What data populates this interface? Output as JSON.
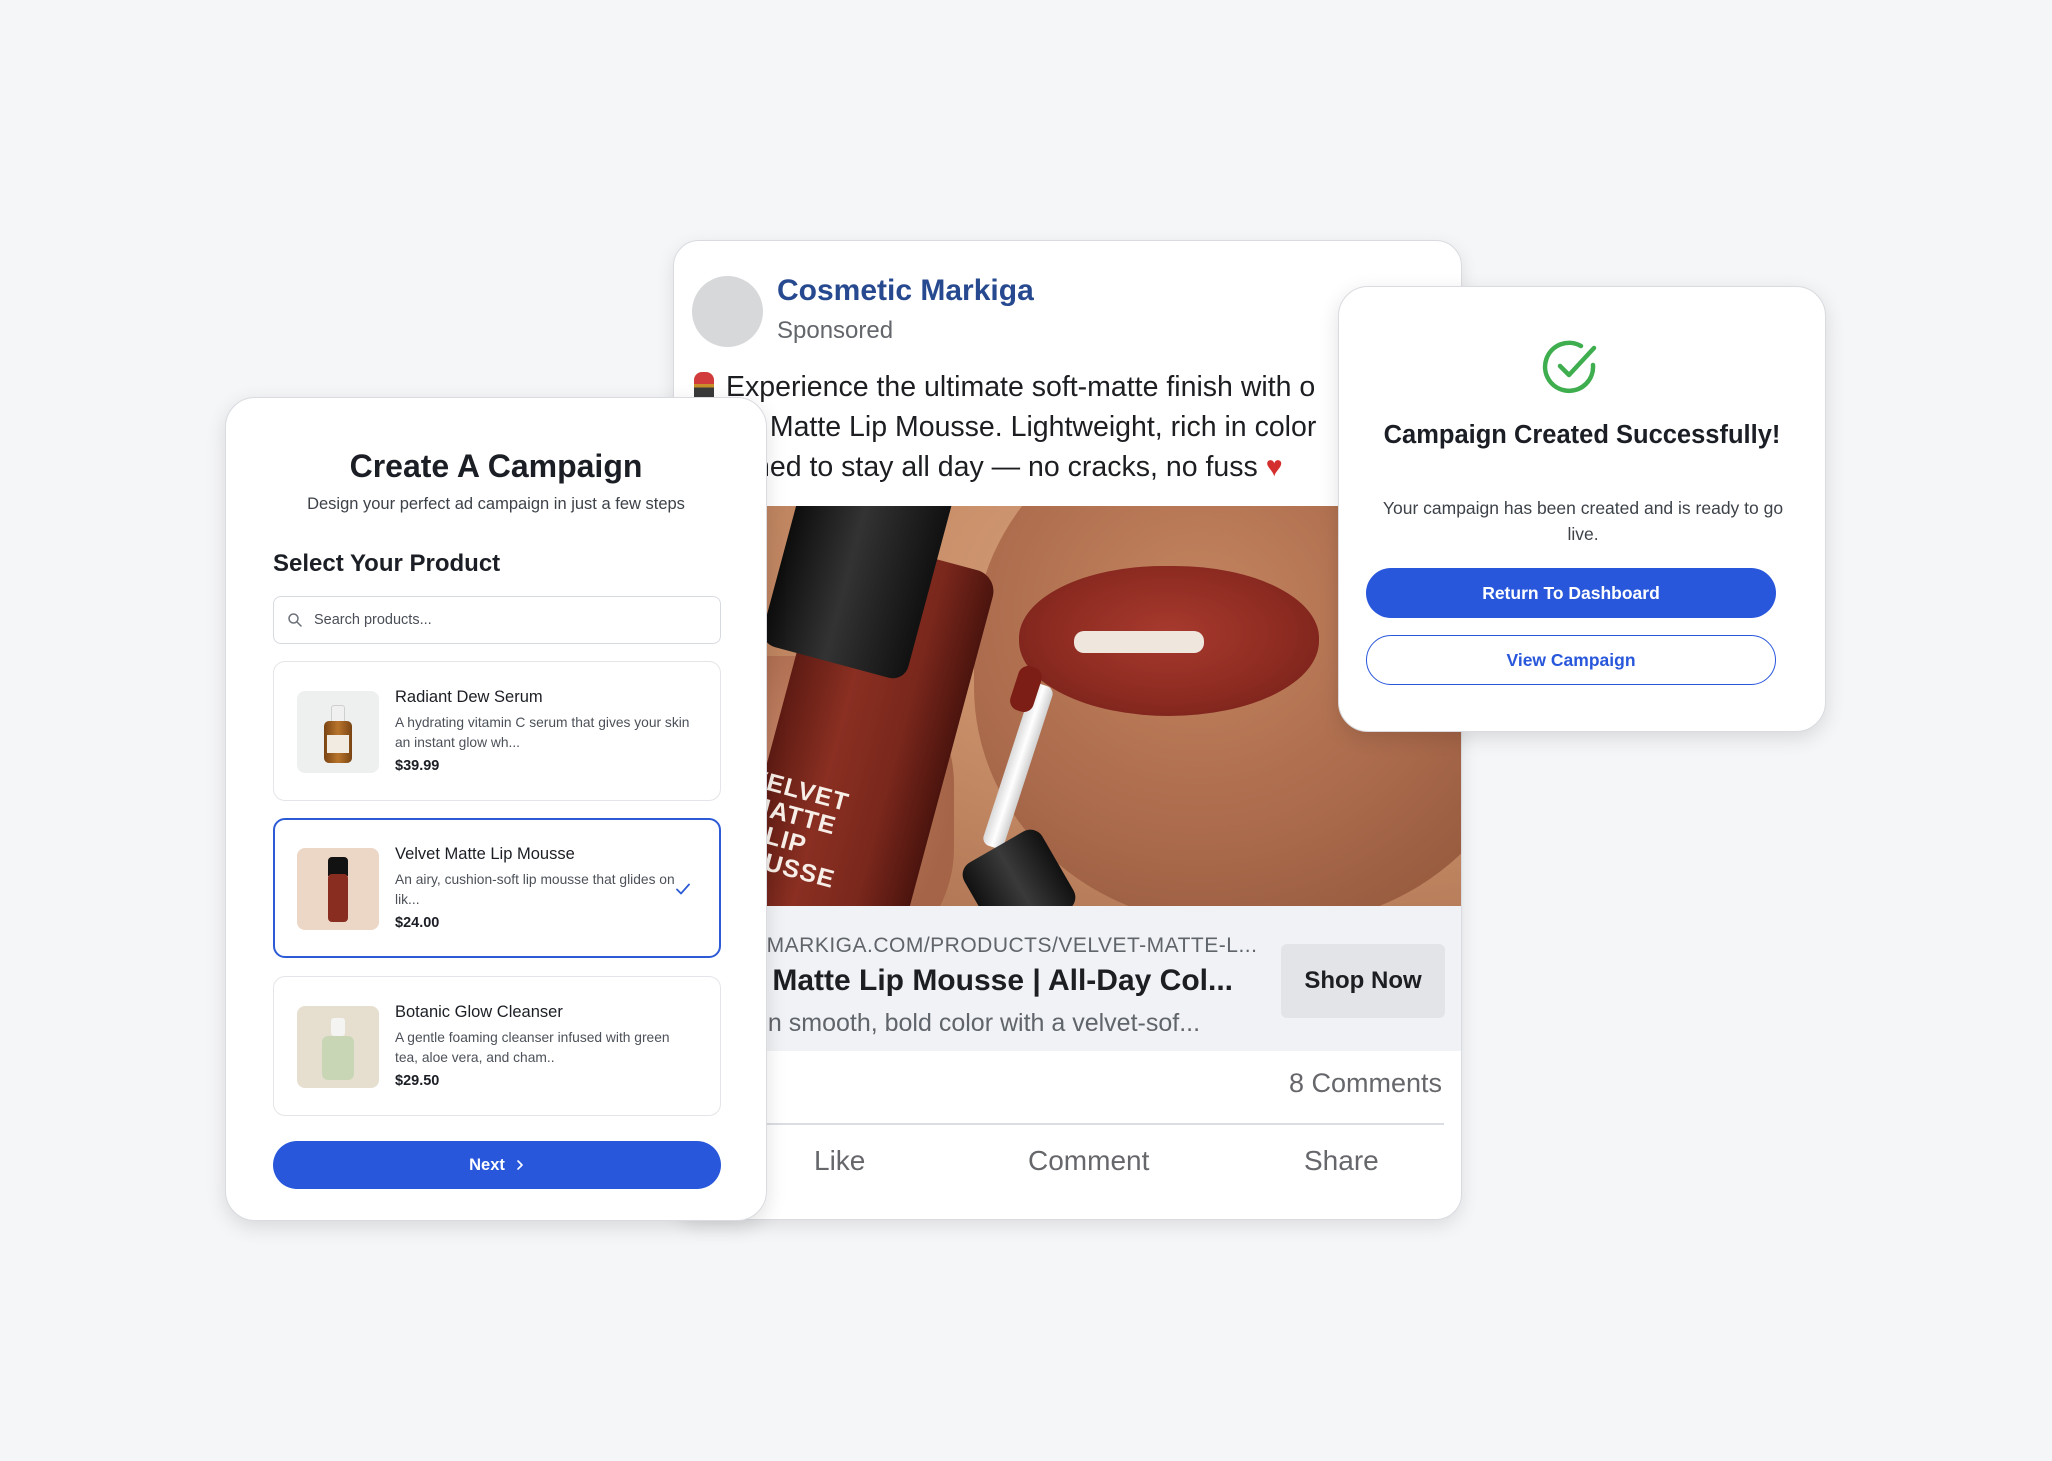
{
  "ad_preview": {
    "page_name": "Cosmetic Markiga",
    "sponsored": "Sponsored",
    "text_line_1": "Experience the ultimate soft-matte finish with o",
    "text_line_2": "t Matte Lip Mousse. Lightweight, rich in color",
    "text_line_3": "ned to stay all day — no cracks, no fuss",
    "image_label": "VELVET MATTE LIP MOUSSE",
    "url": "//MARKIGA.COM/PRODUCTS/VELVET-MATTE-L...",
    "headline": "t Matte Lip Mousse | All-Day Col...",
    "description": "on smooth, bold color with a velvet-sof...",
    "cta": "Shop Now",
    "comments": "8 Comments",
    "actions": {
      "like": "Like",
      "comment": "Comment",
      "share": "Share"
    }
  },
  "campaign": {
    "title": "Create A Campaign",
    "subtitle": "Design your perfect ad campaign in just a few steps",
    "section_title": "Select Your Product",
    "search_placeholder": "Search products...",
    "products": [
      {
        "name": "Radiant Dew Serum",
        "description": "A hydrating vitamin C serum that gives your skin an instant glow wh...",
        "price": "$39.99",
        "selected": false
      },
      {
        "name": "Velvet Matte Lip Mousse",
        "description": "An airy, cushion-soft lip mousse that glides on lik...",
        "price": "$24.00",
        "selected": true
      },
      {
        "name": "Botanic Glow Cleanser",
        "description": "A gentle foaming cleanser infused with green tea, aloe vera, and cham..",
        "price": "$29.50",
        "selected": false
      }
    ],
    "next_label": "Next"
  },
  "success": {
    "title": "Campaign Created Successfully!",
    "message": "Your campaign has been created and is ready to go live.",
    "primary_button": "Return To Dashboard",
    "secondary_button": "View Campaign"
  },
  "colors": {
    "accent": "#2857db",
    "success": "#3fae4f",
    "page_name": "#27498f"
  }
}
